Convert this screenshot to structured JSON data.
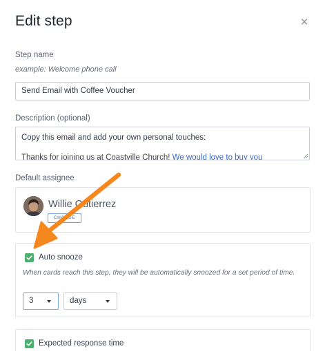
{
  "modal": {
    "title": "Edit step",
    "close_glyph": "×"
  },
  "step_name": {
    "label": "Step name",
    "hint": "example: Welcome phone call",
    "value": "Send Email with Coffee Voucher"
  },
  "description": {
    "label": "Description (optional)",
    "line1": "Copy this email and add your own personal touches:",
    "line2_text": "Thanks for joining us at Coastville Church! ",
    "line2_link": "We would love to buy you"
  },
  "assignee": {
    "label": "Default assignee",
    "name": "Willie Gutierrez",
    "change_label": "CHANGE"
  },
  "auto_snooze": {
    "label": "Auto snooze",
    "checked": true,
    "description": "When cards reach this step, they will be automatically snoozed for a set period of time.",
    "amount": "3",
    "unit": "days"
  },
  "expected_response": {
    "label": "Expected response time",
    "checked": true
  },
  "colors": {
    "checkbox_green": "#4caf6e",
    "annotation_arrow": "#f5871f",
    "link_blue": "#3b66c4"
  }
}
